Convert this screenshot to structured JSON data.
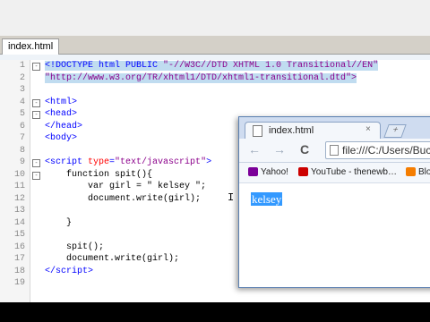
{
  "editor": {
    "file_tab": "index.html",
    "lines": [
      {
        "n": "1",
        "segments": [
          {
            "t": "<!DOCTYPE html PUBLIC ",
            "c": "tag",
            "sel": true
          },
          {
            "t": "\"-//W3C//DTD XHTML 1.0 Transitional//EN\"",
            "c": "str",
            "sel": true
          }
        ]
      },
      {
        "n": "2",
        "segments": [
          {
            "t": "\"http://www.w3.org/TR/xhtml1/DTD/xhtml1-transitional.dtd\">",
            "c": "str",
            "sel": true
          }
        ]
      },
      {
        "n": "3",
        "segments": []
      },
      {
        "n": "4",
        "segments": [
          {
            "t": "<html>",
            "c": "tag"
          }
        ]
      },
      {
        "n": "5",
        "segments": [
          {
            "t": "<head>",
            "c": "tag"
          }
        ]
      },
      {
        "n": "6",
        "segments": [
          {
            "t": "</head>",
            "c": "tag"
          }
        ]
      },
      {
        "n": "7",
        "segments": [
          {
            "t": "<body>",
            "c": "tag"
          }
        ]
      },
      {
        "n": "8",
        "segments": []
      },
      {
        "n": "9",
        "segments": [
          {
            "t": "<script ",
            "c": "tag"
          },
          {
            "t": "type",
            "c": "attr"
          },
          {
            "t": "=",
            "c": "tag"
          },
          {
            "t": "\"text/javascript\"",
            "c": "str"
          },
          {
            "t": ">",
            "c": "tag"
          }
        ]
      },
      {
        "n": "10",
        "segments": [
          {
            "t": "    function spit(){",
            "c": ""
          }
        ]
      },
      {
        "n": "11",
        "segments": [
          {
            "t": "        var girl = \" kelsey \";",
            "c": ""
          }
        ]
      },
      {
        "n": "12",
        "segments": [
          {
            "t": "        document.write(girl);",
            "c": ""
          }
        ]
      },
      {
        "n": "13",
        "segments": []
      },
      {
        "n": "14",
        "segments": [
          {
            "t": "    }",
            "c": ""
          }
        ]
      },
      {
        "n": "15",
        "segments": []
      },
      {
        "n": "16",
        "segments": [
          {
            "t": "    spit();",
            "c": ""
          }
        ]
      },
      {
        "n": "17",
        "segments": [
          {
            "t": "    document.write(girl);",
            "c": ""
          }
        ]
      },
      {
        "n": "18",
        "segments": [
          {
            "t": "</",
            "c": "tag"
          },
          {
            "t": "script",
            "c": "tag"
          },
          {
            "t": ">",
            "c": "tag"
          }
        ]
      },
      {
        "n": "19",
        "segments": []
      }
    ]
  },
  "browser": {
    "tab_title": "index.html",
    "tab_close": "×",
    "address": "file:///C:/Users/Buck",
    "nav_back": "←",
    "nav_forward": "→",
    "nav_reload": "C",
    "new_tab": "+",
    "bookmarks": [
      {
        "label": "Yahoo!",
        "color": "#7b0099"
      },
      {
        "label": "YouTube - thenewb…",
        "color": "#cc0000"
      },
      {
        "label": "Blogg",
        "color": "#f57d00"
      }
    ],
    "output_text": "kelsey"
  }
}
